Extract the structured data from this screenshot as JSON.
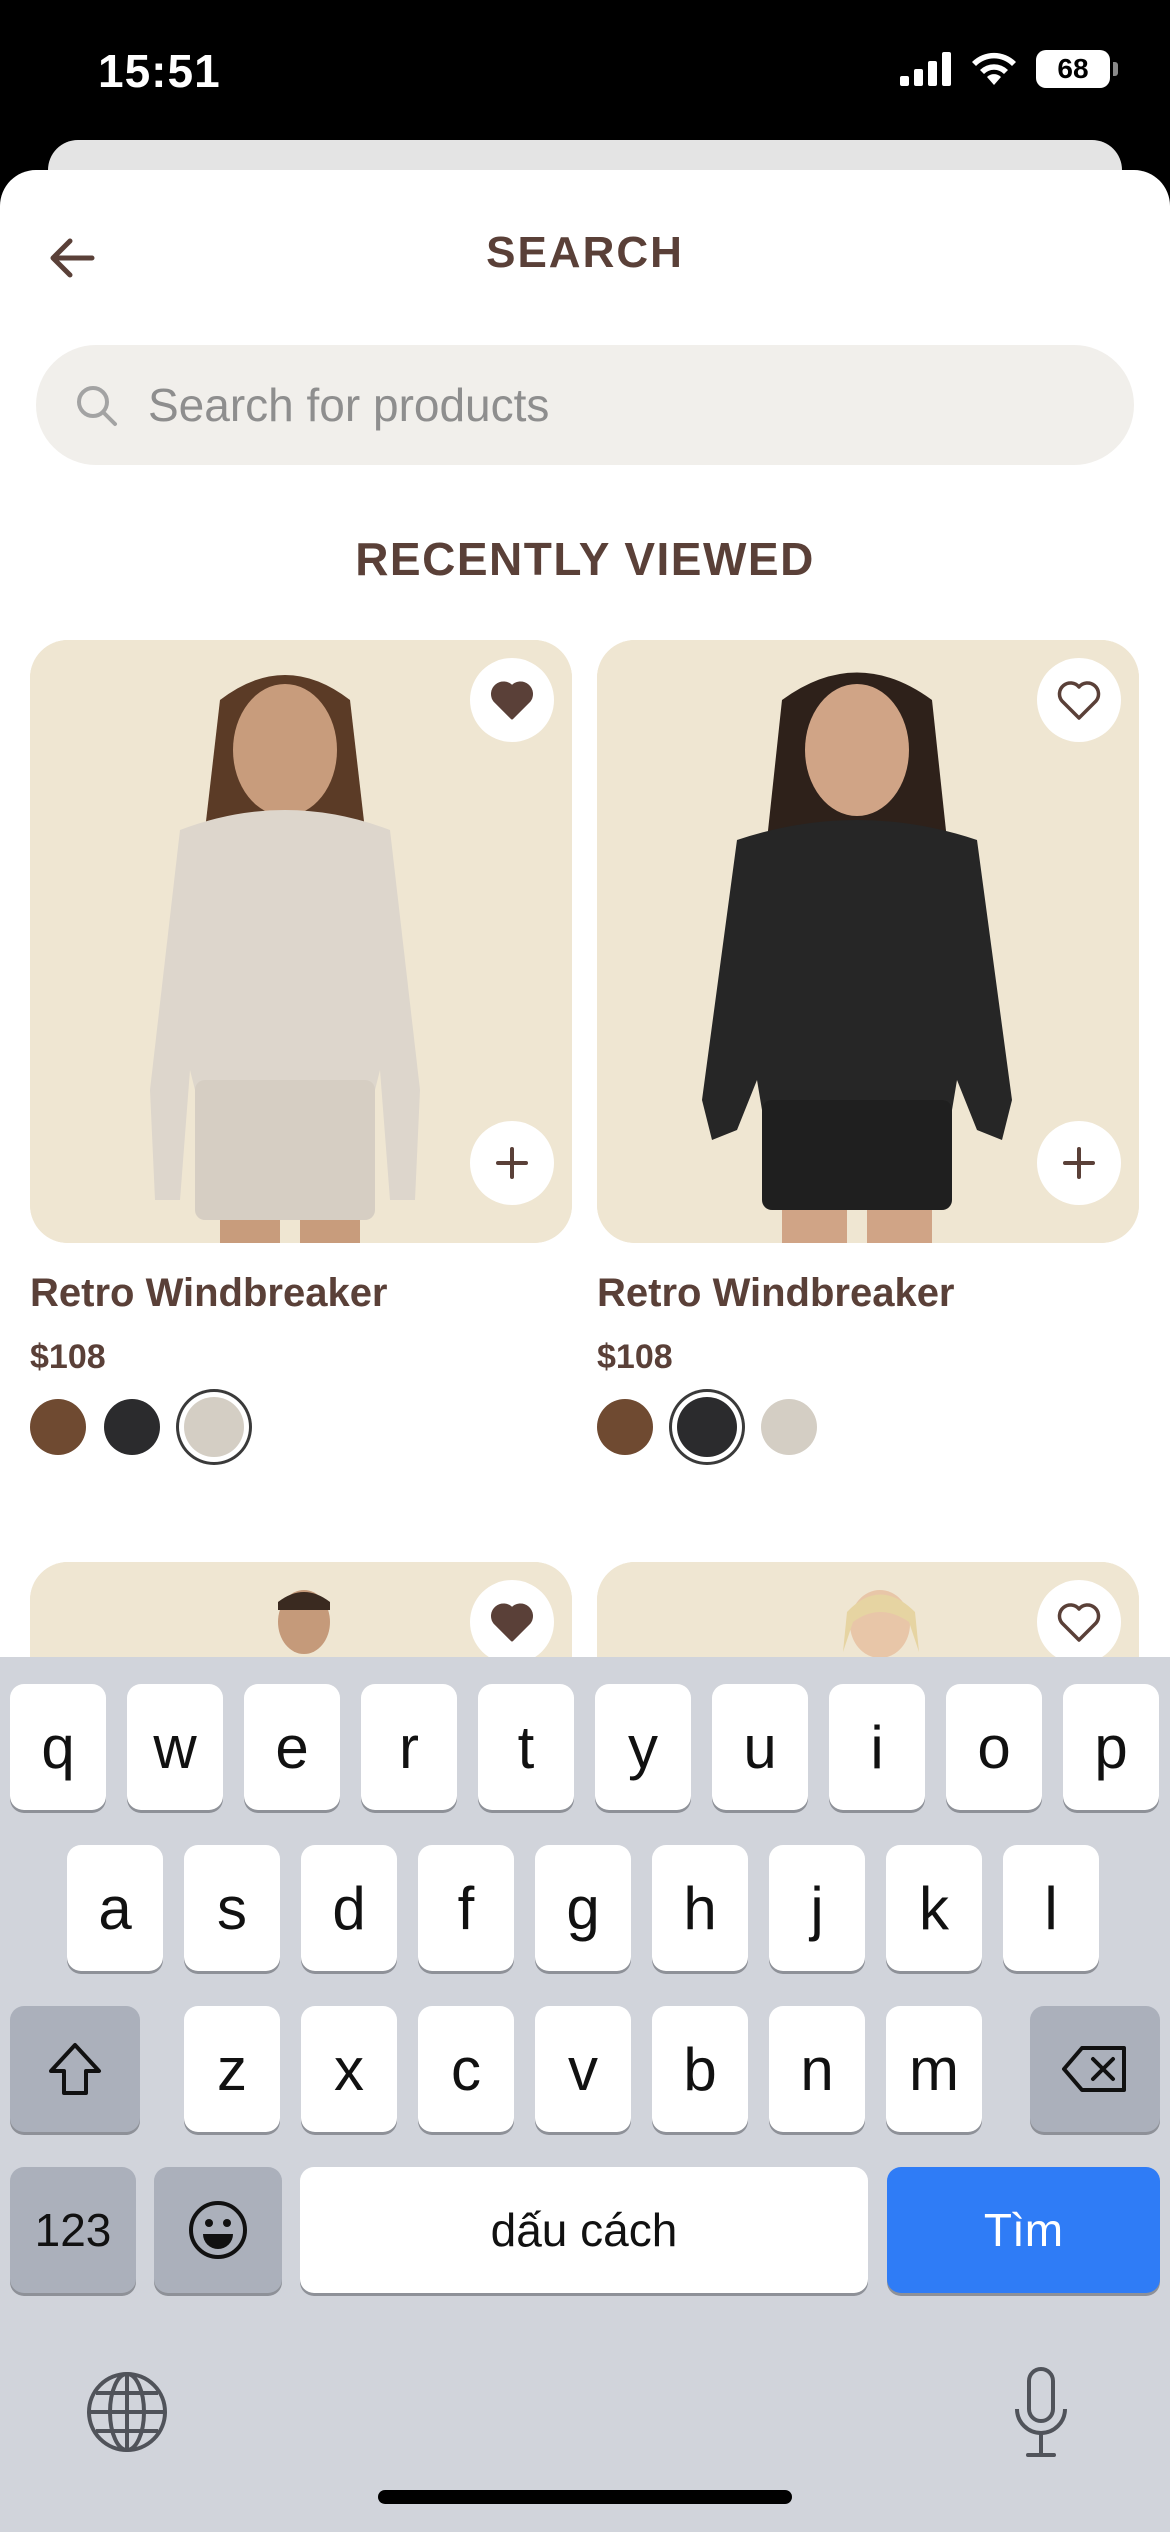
{
  "status_bar": {
    "time": "15:51",
    "battery": "68"
  },
  "header": {
    "title": "SEARCH"
  },
  "search": {
    "placeholder": "Search for products"
  },
  "recent": {
    "title": "RECENTLY VIEWED",
    "items": [
      {
        "name": "Retro Windbreaker",
        "price": "$108",
        "favorited": true,
        "swatches": [
          "#6f4a31",
          "#2b2b2d",
          "#d4cec4"
        ],
        "selected_swatch": 2
      },
      {
        "name": "Retro Windbreaker",
        "price": "$108",
        "favorited": false,
        "swatches": [
          "#6f4a31",
          "#2b2b2d",
          "#d4cec4"
        ],
        "selected_swatch": 1
      }
    ]
  },
  "keyboard": {
    "row1": [
      "q",
      "w",
      "e",
      "r",
      "t",
      "y",
      "u",
      "i",
      "o",
      "p"
    ],
    "row2": [
      "a",
      "s",
      "d",
      "f",
      "g",
      "h",
      "j",
      "k",
      "l"
    ],
    "row3": [
      "z",
      "x",
      "c",
      "v",
      "b",
      "n",
      "m"
    ],
    "numbers_label": "123",
    "space_label": "dấu cách",
    "return_label": "Tìm"
  },
  "colors": {
    "brand_text": "#5a4038",
    "accent_blue": "#2f7cf6"
  }
}
